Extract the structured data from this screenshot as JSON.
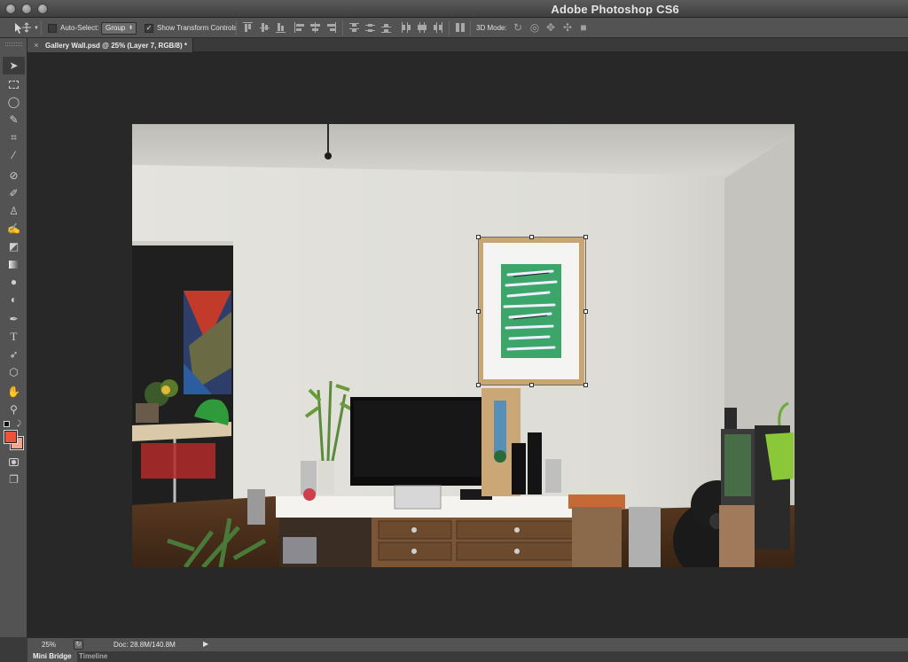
{
  "window": {
    "title": "Adobe Photoshop CS6"
  },
  "options_bar": {
    "tool_icon": "move-tool-icon",
    "auto_select_label": "Auto-Select:",
    "auto_select_checked": false,
    "auto_select_target": "Group",
    "show_transform_label": "Show Transform Controls",
    "show_transform_checked": true,
    "mode_3d_label": "3D Mode:"
  },
  "document_tab": {
    "title": "Gallery Wall.psd @ 25% (Layer 7, RGB/8) *"
  },
  "toolbox": {
    "tools": [
      "move-tool",
      "marquee-tool",
      "lasso-tool",
      "quick-selection-tool",
      "crop-tool",
      "eyedropper-tool",
      "spot-healing-tool",
      "brush-tool",
      "clone-stamp-tool",
      "history-brush-tool",
      "eraser-tool",
      "gradient-tool",
      "blur-tool",
      "dodge-tool",
      "pen-tool",
      "type-tool",
      "path-selection-tool",
      "shape-tool",
      "hand-tool",
      "zoom-tool"
    ],
    "foreground_color": "#e8553a",
    "background_color": "#f2a58f"
  },
  "status_bar": {
    "zoom": "25%",
    "doc_size": "Doc: 28.8M/140.8M"
  },
  "bottom_tabs": [
    {
      "label": "Mini Bridge",
      "active": true
    },
    {
      "label": "Timeline",
      "active": false
    }
  ]
}
